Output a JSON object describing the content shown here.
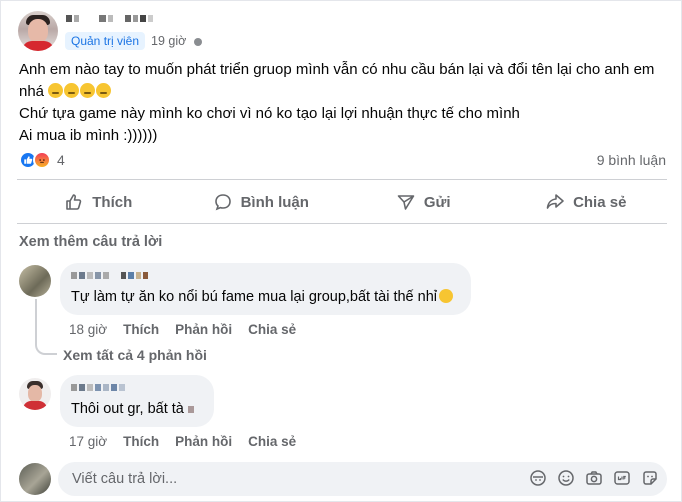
{
  "post": {
    "role": "Quản trị viên",
    "time": "19 giờ",
    "lines": [
      "Anh em nào tay to muốn phát triển gruop mình vẫn có nhu cầu bán lại và đổi tên lại cho anh em",
      "nhá",
      "Chứ tựa game này mình ko chơi vì nó ko tạo lại lợi nhuận thực tế cho mình",
      "Ai mua ib mình :))))))"
    ],
    "reaction_count": "4",
    "comment_count": "9 bình luận"
  },
  "actions": {
    "like": "Thích",
    "comment": "Bình luận",
    "send": "Gửi",
    "share": "Chia sẻ"
  },
  "see_more": "Xem thêm câu trả lời",
  "comments": [
    {
      "text": "Tự làm tự ăn ko nổi bú fame mua lại group,bất tài thế nhỉ",
      "time": "18 giờ",
      "like": "Thích",
      "reply": "Phản hồi",
      "share": "Chia sẻ",
      "view_replies": "Xem tất cả 4 phản hồi"
    },
    {
      "text": "Thôi out gr, bất tà",
      "time": "17 giờ",
      "like": "Thích",
      "reply": "Phản hồi",
      "share": "Chia sẻ"
    }
  ],
  "reply_box": {
    "placeholder": "Viết câu trả lời..."
  },
  "colors": {
    "accent": "#1877f2",
    "secondary_text": "#65676b",
    "bubble": "#f0f2f5"
  }
}
